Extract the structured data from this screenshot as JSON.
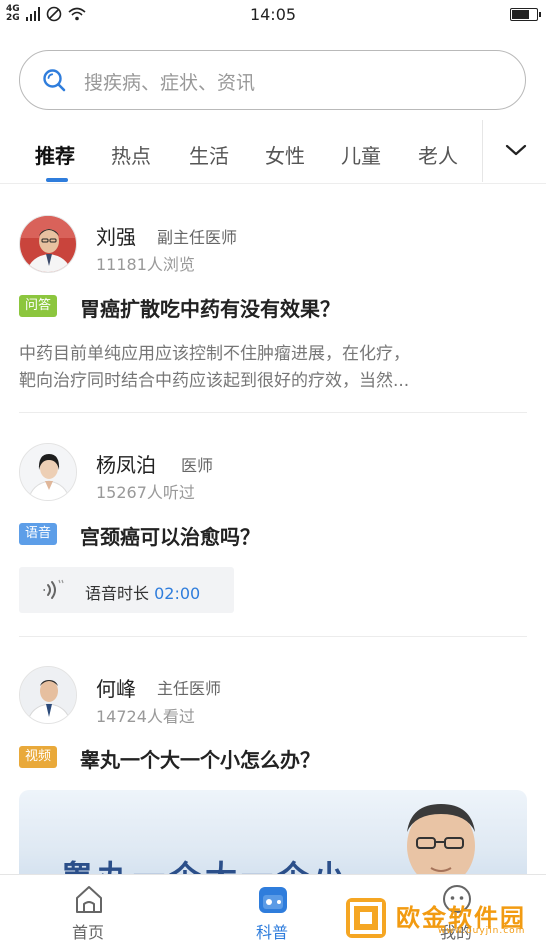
{
  "status_bar": {
    "network_top": "4G",
    "network_bottom": "2G",
    "time": "14:05"
  },
  "search": {
    "placeholder": "搜疾病、症状、资讯"
  },
  "tabs": [
    {
      "label": "推荐",
      "active": true
    },
    {
      "label": "热点",
      "active": false
    },
    {
      "label": "生活",
      "active": false
    },
    {
      "label": "女性",
      "active": false
    },
    {
      "label": "儿童",
      "active": false
    },
    {
      "label": "老人",
      "active": false
    }
  ],
  "feed": [
    {
      "doctor_name": "刘强",
      "doctor_title": "副主任医师",
      "stats": "11181人浏览",
      "type_badge": "问答",
      "question": "胃癌扩散吃中药有没有效果？",
      "excerpt_line1": "中药目前单纯应用应该控制不住肿瘤进展，在化疗，",
      "excerpt_line2": "靶向治疗同时结合中药应该起到很好的疗效，当然..."
    },
    {
      "doctor_name": "杨凤泊",
      "doctor_title": "医师",
      "stats": "15267人听过",
      "type_badge": "语音",
      "question": "宫颈癌可以治愈吗？",
      "voice_label": "语音时长",
      "voice_duration": "02:00"
    },
    {
      "doctor_name": "何峰",
      "doctor_title": "主任医师",
      "stats": "14724人看过",
      "type_badge": "视频",
      "question": "睾丸一个大一个小怎么办？",
      "video_overlay_text": "睾丸一个大一个小"
    }
  ],
  "bottom_nav": [
    {
      "label": "首页",
      "icon": "home-icon",
      "active": false
    },
    {
      "label": "科普",
      "icon": "science-icon",
      "active": true
    },
    {
      "label": "我的",
      "icon": "profile-icon",
      "active": false
    }
  ],
  "watermark": {
    "text": "欧金软件园",
    "url": "www.ouyjin.com"
  },
  "colors": {
    "accent": "#2f7ddc",
    "badge_qa": "#8cc63e",
    "badge_voice": "#5d9ee8",
    "badge_video": "#e9a93a",
    "watermark": "#f29b11"
  }
}
